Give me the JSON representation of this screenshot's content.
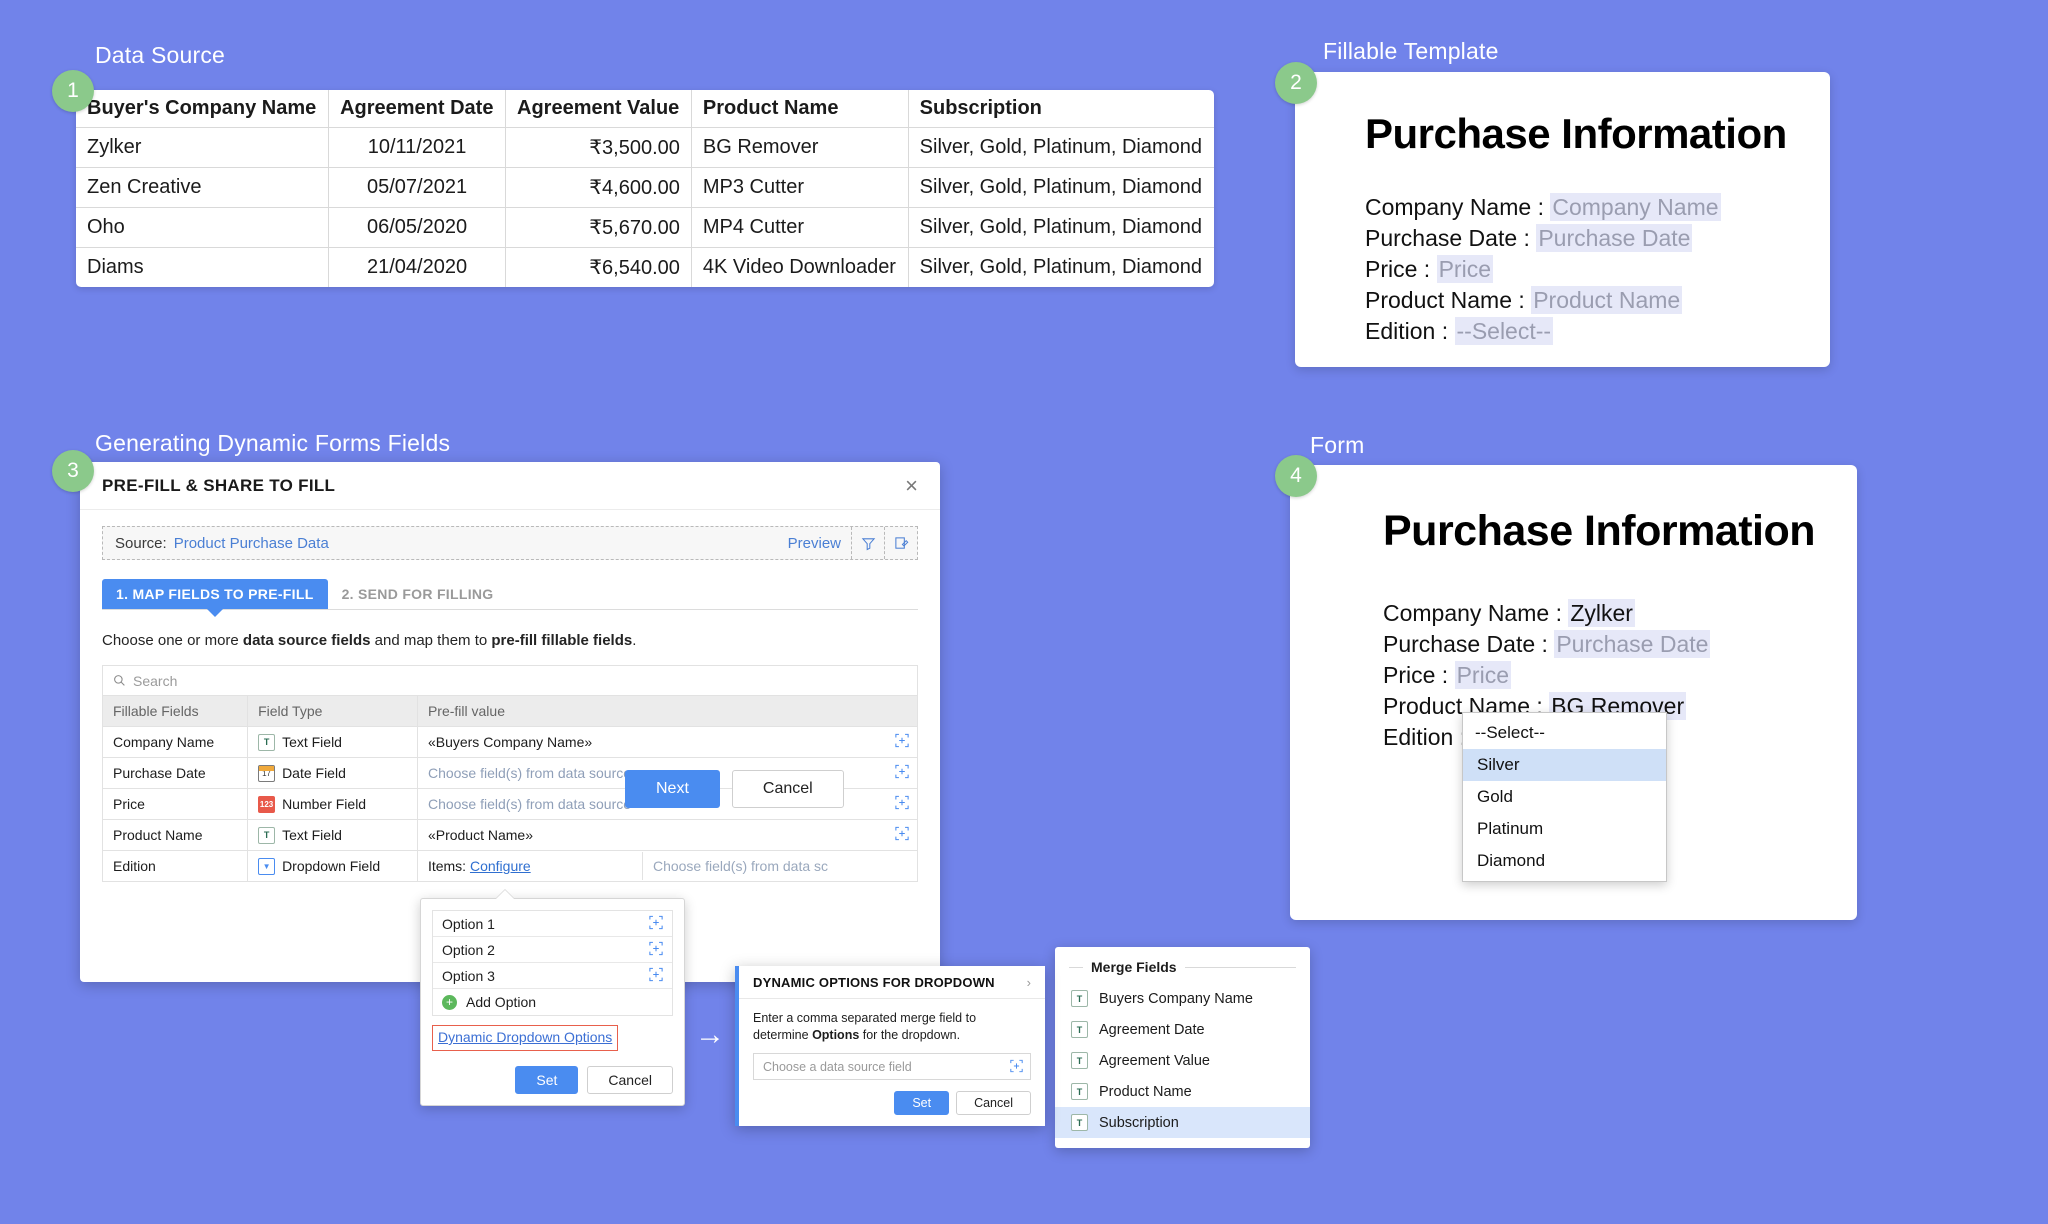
{
  "panels": {
    "data_source_label": "Data Source",
    "fillable_template_label": "Fillable Template",
    "dynamic_forms_label": "Generating Dynamic Forms Fields",
    "form_label": "Form",
    "badge1": "1",
    "badge2": "2",
    "badge3": "3",
    "badge4": "4"
  },
  "data_source": {
    "columns": [
      "Buyer's Company Name",
      "Agreement Date",
      "Agreement Value",
      "Product Name",
      "Subscription"
    ],
    "rows": [
      [
        "Zylker",
        "10/11/2021",
        "₹3,500.00",
        "BG Remover",
        "Silver, Gold, Platinum, Diamond"
      ],
      [
        "Zen Creative",
        "05/07/2021",
        "₹4,600.00",
        "MP3 Cutter",
        "Silver, Gold, Platinum, Diamond"
      ],
      [
        "Oho",
        "06/05/2020",
        "₹5,670.00",
        "MP4 Cutter",
        "Silver, Gold, Platinum, Diamond"
      ],
      [
        "Diams",
        "21/04/2020",
        "₹6,540.00",
        "4K Video Downloader",
        "Silver, Gold, Platinum, Diamond"
      ]
    ]
  },
  "fillable_template": {
    "title": "Purchase Information",
    "lines": [
      {
        "label": "Company Name :",
        "value": "Company Name",
        "filled": false
      },
      {
        "label": "Purchase Date :",
        "value": "Purchase Date",
        "filled": false
      },
      {
        "label": "Price :",
        "value": "Price",
        "filled": false
      },
      {
        "label": "Product Name :",
        "value": "Product Name",
        "filled": false
      },
      {
        "label": "Edition :",
        "value": "--Select--",
        "filled": false
      }
    ]
  },
  "form_doc": {
    "title": "Purchase Information",
    "lines": [
      {
        "label": "Company Name :",
        "value": "Zylker",
        "filled": true
      },
      {
        "label": "Purchase Date :",
        "value": "Purchase Date",
        "filled": false
      },
      {
        "label": "Price :",
        "value": "Price",
        "filled": false
      },
      {
        "label": "Product Name :",
        "value": "BG Remover",
        "filled": true
      },
      {
        "label": "Edition :",
        "value": "Silver",
        "filled": true
      }
    ],
    "dropdown": {
      "items": [
        "--Select--",
        "Silver",
        "Gold",
        "Platinum",
        "Diamond"
      ],
      "selected": "Silver"
    }
  },
  "prefill_dialog": {
    "title": "PRE-FILL & SHARE TO FILL",
    "close_icon": "×",
    "source_label": "Source:",
    "source_value": "Product Purchase Data",
    "preview_label": "Preview",
    "filter_icon": "filter-icon",
    "compose_icon": "compose-icon",
    "tabs": [
      {
        "label": "1. MAP FIELDS TO PRE-FILL",
        "active": true
      },
      {
        "label": "2. SEND FOR FILLING",
        "active": false
      }
    ],
    "helper_prefix": "Choose one or more ",
    "helper_bold1": "data source fields",
    "helper_mid": " and map them to ",
    "helper_bold2": "pre-fill fillable fields",
    "helper_suffix": ".",
    "search_placeholder": "Search",
    "table_headers": [
      "Fillable Fields",
      "Field Type",
      "Pre-fill value"
    ],
    "rows": [
      {
        "field": "Company Name",
        "type": "Text Field",
        "icon": "text-field-icon",
        "value": "«Buyers Company Name»",
        "placeholder": false
      },
      {
        "field": "Purchase Date",
        "type": "Date Field",
        "icon": "date-field-icon",
        "value": "Choose field(s) from data source",
        "placeholder": true
      },
      {
        "field": "Price",
        "type": "Number Field",
        "icon": "number-field-icon",
        "value": "Choose field(s) from data source",
        "placeholder": true
      },
      {
        "field": "Product Name",
        "type": "Text Field",
        "icon": "text-field-icon",
        "value": "«Product Name»",
        "placeholder": false
      }
    ],
    "edition_row": {
      "field": "Edition",
      "type": "Dropdown Field",
      "icon": "dropdown-field-icon",
      "items_label": "Items:",
      "configure_link": "Configure",
      "placeholder": "Choose field(s) from data sc"
    },
    "next_label": "Next",
    "cancel_label": "Cancel"
  },
  "options_popup": {
    "options": [
      "Option 1",
      "Option 2",
      "Option 3"
    ],
    "add_option_label": "Add Option",
    "dynamic_link": "Dynamic Dropdown Options",
    "set_label": "Set",
    "cancel_label": "Cancel"
  },
  "dynamic_dialog": {
    "title": "DYNAMIC OPTIONS FOR DROPDOWN",
    "close_icon": "›",
    "desc_prefix": "Enter a comma separated merge field to determine ",
    "desc_bold": "Options",
    "desc_suffix": " for the dropdown.",
    "input_placeholder": "Choose a data source field",
    "set_label": "Set",
    "cancel_label": "Cancel"
  },
  "merge_fields": {
    "title": "Merge Fields",
    "items": [
      {
        "label": "Buyers Company Name",
        "selected": false
      },
      {
        "label": "Agreement Date",
        "selected": false
      },
      {
        "label": "Agreement Value",
        "selected": false
      },
      {
        "label": "Product Name",
        "selected": false
      },
      {
        "label": "Subscription",
        "selected": true
      }
    ]
  },
  "flow_arrow": "→",
  "colors": {
    "background": "#7183ea",
    "accent_blue": "#4a8cf0",
    "badge_green": "#8bc98b",
    "highlight_red": "#e8604c",
    "merge_chip": "#e6e8f8"
  }
}
